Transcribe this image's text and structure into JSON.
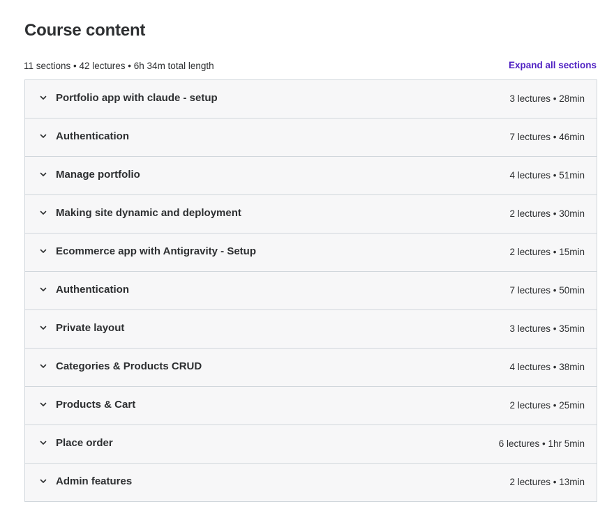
{
  "header": {
    "title": "Course content",
    "summary": "11 sections • 42 lectures • 6h 34m total length",
    "expand_all_label": "Expand all sections"
  },
  "colors": {
    "accent": "#5022c3",
    "text": "#2d2f31",
    "border": "#d1d7dc",
    "section_bg": "#f7f7f8"
  },
  "sections": [
    {
      "title": "Portfolio app with claude - setup",
      "meta": "3 lectures • 28min",
      "icon": "chevron-down-icon"
    },
    {
      "title": "Authentication",
      "meta": "7 lectures • 46min",
      "icon": "chevron-down-icon"
    },
    {
      "title": "Manage portfolio",
      "meta": "4 lectures • 51min",
      "icon": "chevron-down-icon"
    },
    {
      "title": "Making site dynamic and deployment",
      "meta": "2 lectures • 30min",
      "icon": "chevron-down-icon"
    },
    {
      "title": "Ecommerce app with Antigravity - Setup",
      "meta": "2 lectures • 15min",
      "icon": "chevron-down-icon"
    },
    {
      "title": "Authentication",
      "meta": "7 lectures • 50min",
      "icon": "chevron-down-icon"
    },
    {
      "title": "Private layout",
      "meta": "3 lectures • 35min",
      "icon": "chevron-down-icon"
    },
    {
      "title": "Categories & Products CRUD",
      "meta": "4 lectures • 38min",
      "icon": "chevron-down-icon"
    },
    {
      "title": "Products & Cart",
      "meta": "2 lectures • 25min",
      "icon": "chevron-down-icon"
    },
    {
      "title": "Place order",
      "meta": "6 lectures • 1hr 5min",
      "icon": "chevron-down-icon"
    },
    {
      "title": "Admin features",
      "meta": "2 lectures • 13min",
      "icon": "chevron-down-icon"
    }
  ]
}
